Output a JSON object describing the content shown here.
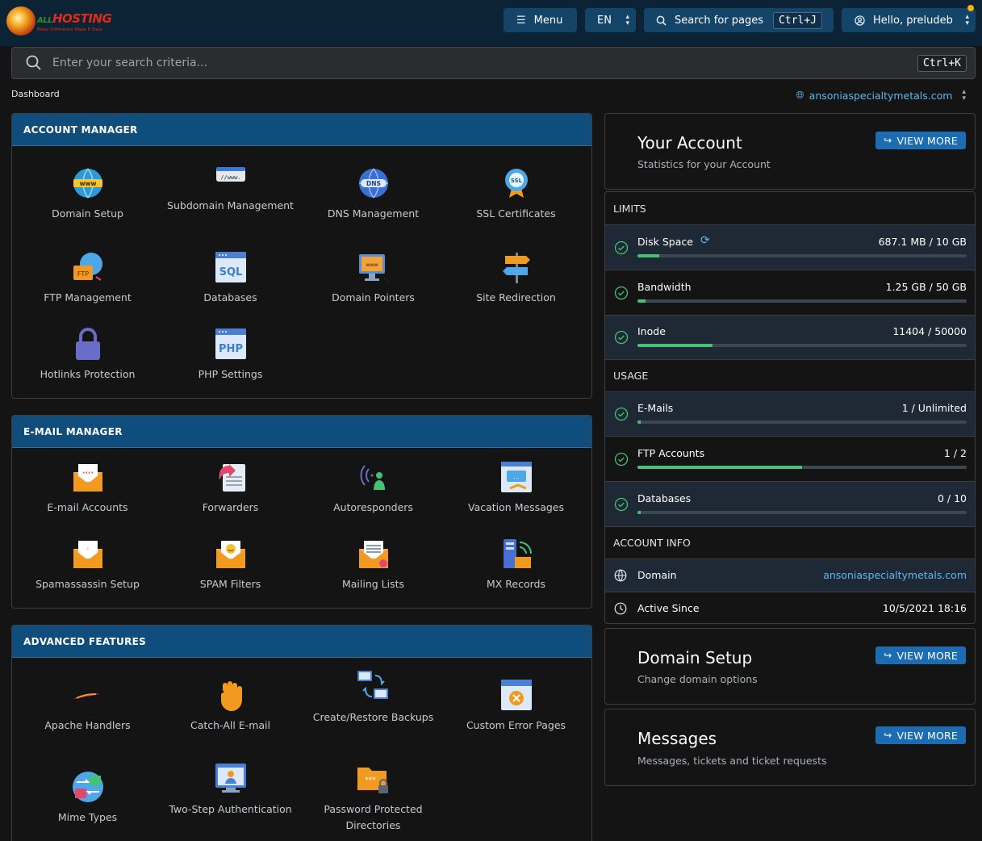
{
  "brand": {
    "name": "HOSTING",
    "prefix": "ALL",
    "tagline": "Make Difference Make It Easy"
  },
  "topbar": {
    "menu_label": "Menu",
    "lang_label": "EN",
    "search_label": "Search for pages",
    "search_shortcut": "Ctrl+J",
    "user_label": "Hello, preludeb"
  },
  "search": {
    "placeholder": "Enter your search criteria...",
    "shortcut": "Ctrl+K"
  },
  "breadcrumb": "Dashboard",
  "domain_selector": "ansoniaspecialtymetals.com",
  "account_manager": {
    "title": "ACCOUNT MANAGER",
    "items": [
      {
        "label": "Domain Setup",
        "icon": "www-globe-icon"
      },
      {
        "label": "Subdomain Management",
        "icon": "subdomain-bar-icon"
      },
      {
        "label": "DNS Management",
        "icon": "dns-globe-icon"
      },
      {
        "label": "SSL Certificates",
        "icon": "ssl-badge-icon"
      },
      {
        "label": "FTP Management",
        "icon": "ftp-icon"
      },
      {
        "label": "Databases",
        "icon": "sql-icon"
      },
      {
        "label": "Domain Pointers",
        "icon": "domain-pointer-icon"
      },
      {
        "label": "Site Redirection",
        "icon": "signpost-icon"
      },
      {
        "label": "Hotlinks Protection",
        "icon": "padlock-icon"
      },
      {
        "label": "PHP Settings",
        "icon": "php-icon"
      }
    ]
  },
  "email_manager": {
    "title": "E-MAIL MANAGER",
    "items": [
      {
        "label": "E-mail Accounts",
        "icon": "envelope-password-icon"
      },
      {
        "label": "Forwarders",
        "icon": "forward-icon"
      },
      {
        "label": "Autoresponders",
        "icon": "autoresponder-icon"
      },
      {
        "label": "Vacation Messages",
        "icon": "vacation-window-icon"
      },
      {
        "label": "Spamassassin Setup",
        "icon": "envelope-info-icon"
      },
      {
        "label": "SPAM Filters",
        "icon": "envelope-smile-icon"
      },
      {
        "label": "Mailing Lists",
        "icon": "envelope-list-icon"
      },
      {
        "label": "MX Records",
        "icon": "mx-server-icon"
      }
    ]
  },
  "advanced_features": {
    "title": "ADVANCED FEATURES",
    "items": [
      {
        "label": "Apache Handlers",
        "icon": "apache-feather-icon"
      },
      {
        "label": "Catch-All E-mail",
        "icon": "hand-icon"
      },
      {
        "label": "Create/Restore Backups",
        "icon": "backup-computers-icon"
      },
      {
        "label": "Custom Error Pages",
        "icon": "error-page-icon"
      },
      {
        "label": "Mime Types",
        "icon": "mime-types-icon"
      },
      {
        "label": "Two-Step Authentication",
        "icon": "two-step-icon"
      },
      {
        "label": "Password Protected Directories",
        "icon": "locked-folder-icon"
      }
    ]
  },
  "your_account": {
    "title": "Your Account",
    "subtitle": "Statistics for your Account",
    "button": "VIEW MORE"
  },
  "limits": {
    "title": "LIMITS",
    "rows": [
      {
        "label": "Disk Space",
        "value": "687.1 MB / 10 GB",
        "fraction": 0.067
      },
      {
        "label": "Bandwidth",
        "value": "1.25 GB / 50 GB",
        "fraction": 0.025
      },
      {
        "label": "Inode",
        "value": "11404 / 50000",
        "fraction": 0.228
      }
    ]
  },
  "usage": {
    "title": "USAGE",
    "rows": [
      {
        "label": "E-Mails",
        "value": "1 / Unlimited",
        "fraction": 0.01
      },
      {
        "label": "FTP Accounts",
        "value": "1 / 2",
        "fraction": 0.5
      },
      {
        "label": "Databases",
        "value": "0 / 10",
        "fraction": 0.01
      }
    ]
  },
  "account_info": {
    "title": "ACCOUNT INFO",
    "domain_label": "Domain",
    "domain_value": "ansoniaspecialtymetals.com",
    "since_label": "Active Since",
    "since_value": "10/5/2021 18:16"
  },
  "domain_setup_card": {
    "title": "Domain Setup",
    "subtitle": "Change domain options",
    "button": "VIEW MORE"
  },
  "messages_card": {
    "title": "Messages",
    "subtitle": "Messages, tickets and ticket requests",
    "button": "VIEW MORE"
  },
  "colors": {
    "accent": "#0f4e7c",
    "button": "#1c6cb4",
    "progress": "#44c373",
    "link": "#5eb7ee"
  }
}
